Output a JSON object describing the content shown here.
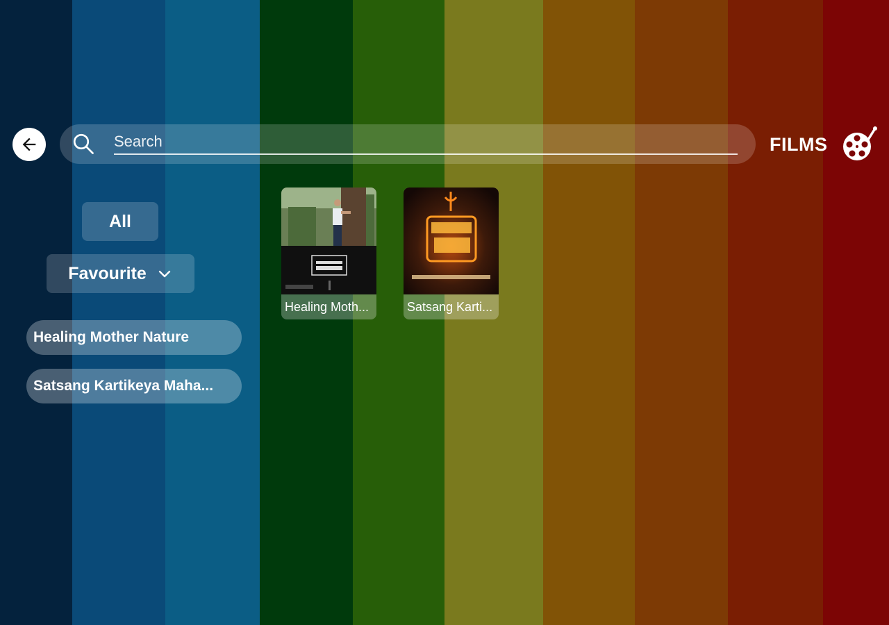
{
  "theme": {
    "stripes": [
      {
        "color": "#04223d",
        "width": 104
      },
      {
        "color": "#0a4a78",
        "width": 134
      },
      {
        "color": "#0b5d85",
        "width": 136
      },
      {
        "color": "#003a0c",
        "width": 134
      },
      {
        "color": "#275e08",
        "width": 132
      },
      {
        "color": "#7a7a1e",
        "width": 142
      },
      {
        "color": "#815306",
        "width": 132
      },
      {
        "color": "#7d3a05",
        "width": 134
      },
      {
        "color": "#7a1e03",
        "width": 137
      },
      {
        "color": "#7c0505",
        "width": 95
      }
    ]
  },
  "header": {
    "back_icon": "arrow-left-icon",
    "search": {
      "placeholder": "Search",
      "value": "",
      "icon": "search-icon"
    },
    "section_label": "FILMS",
    "section_icon": "film-reel-icon"
  },
  "filters": {
    "all_label": "All",
    "favourite_label": "Favourite",
    "favourite_icon": "chevron-down-icon"
  },
  "sidebar_list": [
    {
      "label": "Healing Mother Nature"
    },
    {
      "label": "Satsang Kartikeya Maha..."
    }
  ],
  "films": [
    {
      "caption": "Healing Moth...",
      "thumb_text": "HEALING OF NATURE"
    },
    {
      "caption": "Satsang Karti...",
      "thumb_text": "सनातन का सत्य",
      "thumb_sub": "सनातन और सनातन धर्म की कहानी"
    }
  ]
}
